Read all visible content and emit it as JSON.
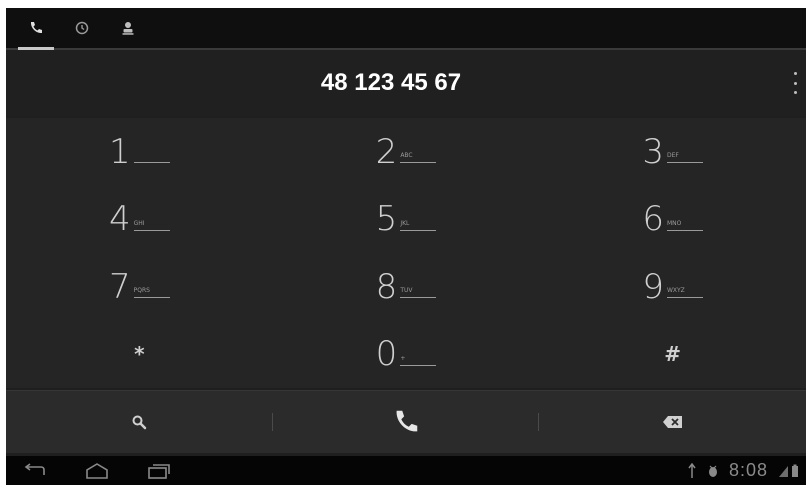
{
  "tabs": [
    {
      "name": "phone",
      "icon": "phone-icon",
      "active": true
    },
    {
      "name": "recent",
      "icon": "clock-icon",
      "active": false
    },
    {
      "name": "contacts",
      "icon": "contacts-icon",
      "active": false
    }
  ],
  "dialer": {
    "number": "48 123 45 67",
    "keys": [
      {
        "digit": "1",
        "letters": ""
      },
      {
        "digit": "2",
        "letters": "ABC"
      },
      {
        "digit": "3",
        "letters": "DEF"
      },
      {
        "digit": "4",
        "letters": "GHI"
      },
      {
        "digit": "5",
        "letters": "JKL"
      },
      {
        "digit": "6",
        "letters": "MNO"
      },
      {
        "digit": "7",
        "letters": "PQRS"
      },
      {
        "digit": "8",
        "letters": "TUV"
      },
      {
        "digit": "9",
        "letters": "WXYZ"
      },
      {
        "symbol": "*"
      },
      {
        "digit": "0",
        "letters": "+"
      },
      {
        "symbol": "#"
      }
    ]
  },
  "actions": {
    "search_icon": "search-icon",
    "call_icon": "phone-call-icon",
    "delete_icon": "backspace-icon"
  },
  "statusbar": {
    "time": "8:08"
  },
  "colors": {
    "background": "#1f1f1f",
    "call_accent": "#e6e6e6",
    "text": "#cfcfcf"
  }
}
